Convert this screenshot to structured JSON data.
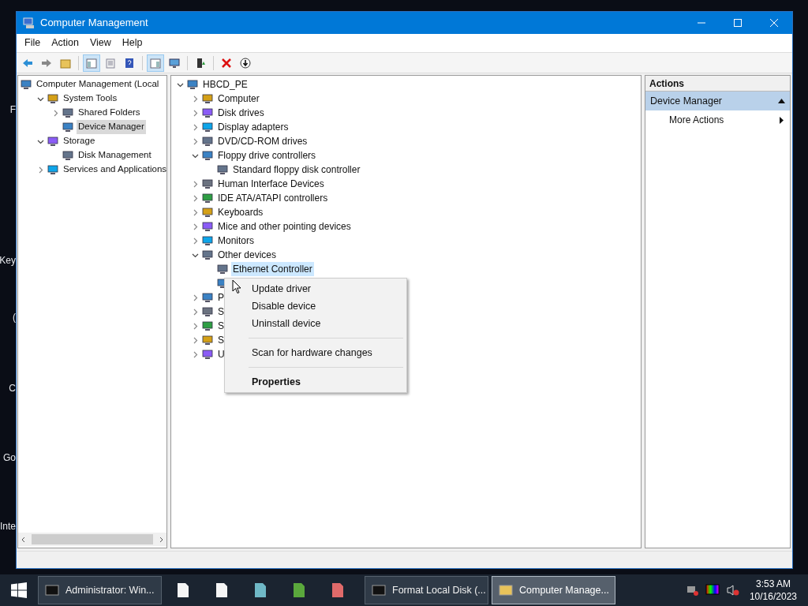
{
  "desktop_labels": [
    "F",
    "Key",
    "(",
    "C",
    "Go",
    "Inte"
  ],
  "window": {
    "title": "Computer Management"
  },
  "menu_bar": [
    "File",
    "Action",
    "View",
    "Help"
  ],
  "toolbar": [
    {
      "on": false
    },
    {
      "on": false
    },
    {
      "on": false
    },
    {
      "on": true
    },
    {
      "on": false
    },
    {
      "on": false
    },
    {
      "on": true
    },
    {
      "on": false
    },
    {
      "on": false
    },
    {
      "on": false
    },
    {
      "on": false
    }
  ],
  "console_tree": [
    {
      "label": "Computer Management (Local",
      "selected": false,
      "children": [
        {
          "label": "System Tools",
          "expanded": true,
          "selected": false,
          "children": [
            {
              "label": "Shared Folders",
              "expanded": false,
              "selected": false
            },
            {
              "label": "Device Manager",
              "selected": true
            }
          ]
        },
        {
          "label": "Storage",
          "expanded": true,
          "selected": false,
          "children": [
            {
              "label": "Disk Management",
              "selected": false
            }
          ]
        },
        {
          "label": "Services and Applications",
          "expanded": false,
          "selected": false
        }
      ]
    }
  ],
  "device_tree": [
    {
      "label": "HBCD_PE",
      "expanded": true,
      "selected": false,
      "children": [
        {
          "label": "Computer",
          "expanded": false,
          "selected": false
        },
        {
          "label": "Disk drives",
          "expanded": false,
          "selected": false
        },
        {
          "label": "Display adapters",
          "expanded": false,
          "selected": false
        },
        {
          "label": "DVD/CD-ROM drives",
          "expanded": false,
          "selected": false
        },
        {
          "label": "Floppy drive controllers",
          "expanded": true,
          "selected": false,
          "children": [
            {
              "label": "Standard floppy disk controller",
              "selected": false
            }
          ]
        },
        {
          "label": "Human Interface Devices",
          "expanded": false,
          "selected": false
        },
        {
          "label": "IDE ATA/ATAPI controllers",
          "expanded": false,
          "selected": false
        },
        {
          "label": "Keyboards",
          "expanded": false,
          "selected": false
        },
        {
          "label": "Mice and other pointing devices",
          "expanded": false,
          "selected": false
        },
        {
          "label": "Monitors",
          "expanded": false,
          "selected": false
        },
        {
          "label": "Other devices",
          "expanded": true,
          "selected": false,
          "children": [
            {
              "kind": "device",
              "label": "Ethernet Controller",
              "selected": true
            },
            {
              "kind": "covered"
            }
          ]
        },
        {
          "label": "P",
          "expanded": false,
          "selected": false
        },
        {
          "label": "S",
          "expanded": false,
          "selected": false
        },
        {
          "label": "S",
          "expanded": false,
          "selected": false
        },
        {
          "label": "S",
          "expanded": false,
          "selected": false
        },
        {
          "label": "U",
          "expanded": false,
          "selected": false
        }
      ]
    }
  ],
  "context_menu": [
    {
      "kind": "item",
      "label": "Update driver"
    },
    {
      "kind": "item",
      "label": "Disable device"
    },
    {
      "kind": "item",
      "label": "Uninstall device"
    },
    {
      "kind": "separator"
    },
    {
      "kind": "item",
      "label": "Scan for hardware changes"
    },
    {
      "kind": "separator"
    },
    {
      "kind": "default",
      "label": "Properties"
    }
  ],
  "actions": {
    "title": "Actions",
    "section": {
      "label": "Device Manager",
      "expanded": true
    },
    "items": [
      {
        "label": "More Actions"
      }
    ]
  },
  "taskbar": [
    {
      "kind": "button",
      "label": "Administrator: Win...",
      "selected": false
    },
    {
      "kind": "icon"
    },
    {
      "kind": "icon"
    },
    {
      "kind": "icon"
    },
    {
      "kind": "icon"
    },
    {
      "kind": "icon"
    },
    {
      "kind": "button",
      "label": "Format Local Disk (...",
      "selected": false
    },
    {
      "kind": "button",
      "label": "Computer Manage...",
      "selected": true
    }
  ],
  "clock": {
    "time": "3:53 AM",
    "date": "10/16/2023"
  }
}
